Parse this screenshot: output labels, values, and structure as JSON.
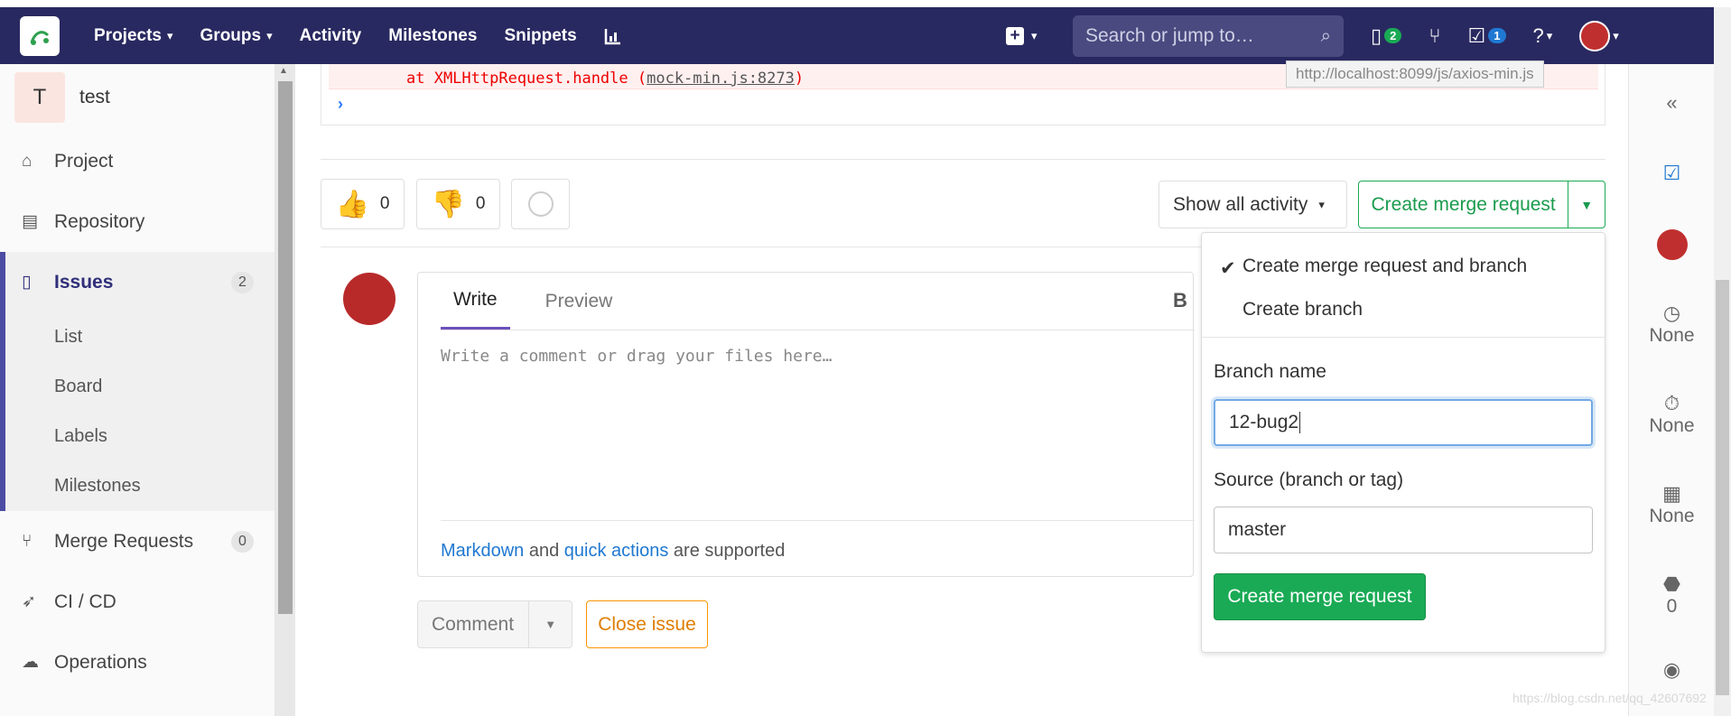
{
  "nav": {
    "links": [
      {
        "label": "Projects",
        "has_caret": true
      },
      {
        "label": "Groups",
        "has_caret": true
      },
      {
        "label": "Activity",
        "has_caret": false
      },
      {
        "label": "Milestones",
        "has_caret": false
      },
      {
        "label": "Snippets",
        "has_caret": false
      }
    ],
    "search_placeholder": "Search or jump to…",
    "issues_count": "2",
    "todos_count": "1"
  },
  "sidebar": {
    "project_initial": "T",
    "project_name": "test",
    "items": [
      {
        "label": "Project"
      },
      {
        "label": "Repository"
      },
      {
        "label": "Issues",
        "count": "2"
      },
      {
        "label": "Merge Requests",
        "count": "0"
      },
      {
        "label": "CI / CD"
      },
      {
        "label": "Operations"
      }
    ],
    "issue_subitems": [
      "List",
      "Board",
      "Labels",
      "Milestones"
    ]
  },
  "console": {
    "error_prefix": "at XMLHttpRequest.handle (",
    "error_link": "mock-min.js:8273",
    "error_suffix": ")",
    "tooltip_url": "http://localhost:8099/js/axios-min.js",
    "prompt": "›"
  },
  "awards": {
    "thumbs_up_count": "0",
    "thumbs_down_count": "0"
  },
  "activity_filter": "Show all activity",
  "create_mr_button": "Create merge request",
  "editor": {
    "tab_write": "Write",
    "tab_preview": "Preview",
    "bold_tool": "B",
    "placeholder": "Write a comment or drag your files here…",
    "footer_markdown": "Markdown",
    "footer_and": " and ",
    "footer_quick_actions": "quick actions",
    "footer_supported": " are supported"
  },
  "comment_button": "Comment",
  "close_issue_button": "Close issue",
  "dropdown": {
    "option_selected": "Create merge request and branch",
    "option_other": "Create branch",
    "branch_label": "Branch name",
    "branch_value": "12-bug2",
    "source_label": "Source (branch or tag)",
    "source_value": "master",
    "submit_label": "Create merge request"
  },
  "right_sidebar": {
    "milestone": "None",
    "time_tracking": "None",
    "due_date": "None",
    "labels_count": "0"
  },
  "watermark": "https://blog.csdn.net/qq_42607692",
  "colors": {
    "navbar": "#292961",
    "success": "#1aaa55",
    "link": "#1f78d1",
    "warning": "#fc9403",
    "error_text": "#ee0000"
  }
}
